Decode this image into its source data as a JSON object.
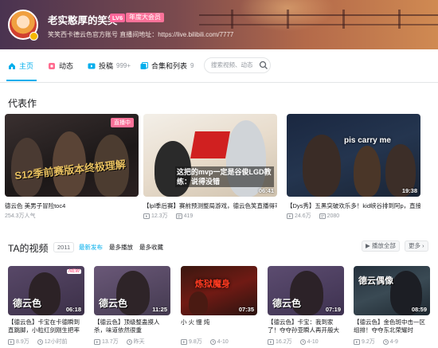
{
  "header": {
    "username": "老实憨厚的笑笑",
    "level": "LV6",
    "vip": "年度大会员",
    "sign": "笑笑西卡德云色官方账号 直播间地址：https://live.bilibili.com/7777"
  },
  "nav": {
    "tabs": [
      {
        "label": "主页",
        "count": "",
        "icon": "home-icon"
      },
      {
        "label": "动态",
        "count": "",
        "icon": "dynamic-icon"
      },
      {
        "label": "投稿",
        "count": "999+",
        "icon": "upload-icon"
      },
      {
        "label": "合集和列表",
        "count": "9",
        "icon": "collection-icon"
      }
    ],
    "search_placeholder": "搜索视频、动态"
  },
  "featured": {
    "title": "代表作",
    "items": [
      {
        "title": "德云色 美男子冒险toc4",
        "views": "254.3万人气",
        "comments": "",
        "duration": "",
        "live": "直播中",
        "art_text": "S12季前赛版本终极理解"
      },
      {
        "title": "【lpl季后赛】赛前预测整局游戏，德云色笑直播得可",
        "views": "12.3万",
        "comments": "419",
        "duration": "06:41",
        "live": "",
        "art_text": "这把的mvp一定是谷俊LGD教练：说得没错"
      },
      {
        "title": "【Dys秀】五黑突破欢乐多！kid峡谷排到阿p，直接",
        "views": "24.6万",
        "comments": "2080",
        "duration": "19:38",
        "live": "",
        "art_text": "pis carry me"
      }
    ]
  },
  "videos": {
    "title": "TA的视频",
    "year": "2011",
    "sort_tabs": [
      "最新发布",
      "最多播放",
      "最多收藏"
    ],
    "play_all": "播放全部",
    "more": "更多",
    "items": [
      {
        "title": "【德云色】卡宝在卡德瞬到直跳脚，小粒红剑刚生把率败",
        "views": "8.9万",
        "date": "12小时前",
        "duration": "06:18",
        "badge": "NEW",
        "art_text": "德云色"
      },
      {
        "title": "【德云色】顶级整蛊摸人杀，味道依然很重（2022.4.10）",
        "views": "13.7万",
        "date": "昨天",
        "duration": "11:25",
        "badge": "",
        "art_text": "德云色"
      },
      {
        "title": "小 火 慢 炖",
        "views": "9.8万",
        "date": "4-10",
        "duration": "07:35",
        "badge": "",
        "art_text": "炼狱魔身"
      },
      {
        "title": "【德云色】卡宝：我到家了！夺夺孙亚瞬人再开般大秀",
        "views": "16.2万",
        "date": "4-10",
        "duration": "07:19",
        "badge": "",
        "art_text": "德云色"
      },
      {
        "title": "【德云色】金色斑中击一区组排！夺夺东北荣耀时",
        "views": "9.2万",
        "date": "4-9",
        "duration": "08:59",
        "badge": "",
        "art_text": "德云偶像"
      }
    ]
  },
  "colors": {
    "accent": "#00aeec",
    "pink": "#fb7299"
  }
}
